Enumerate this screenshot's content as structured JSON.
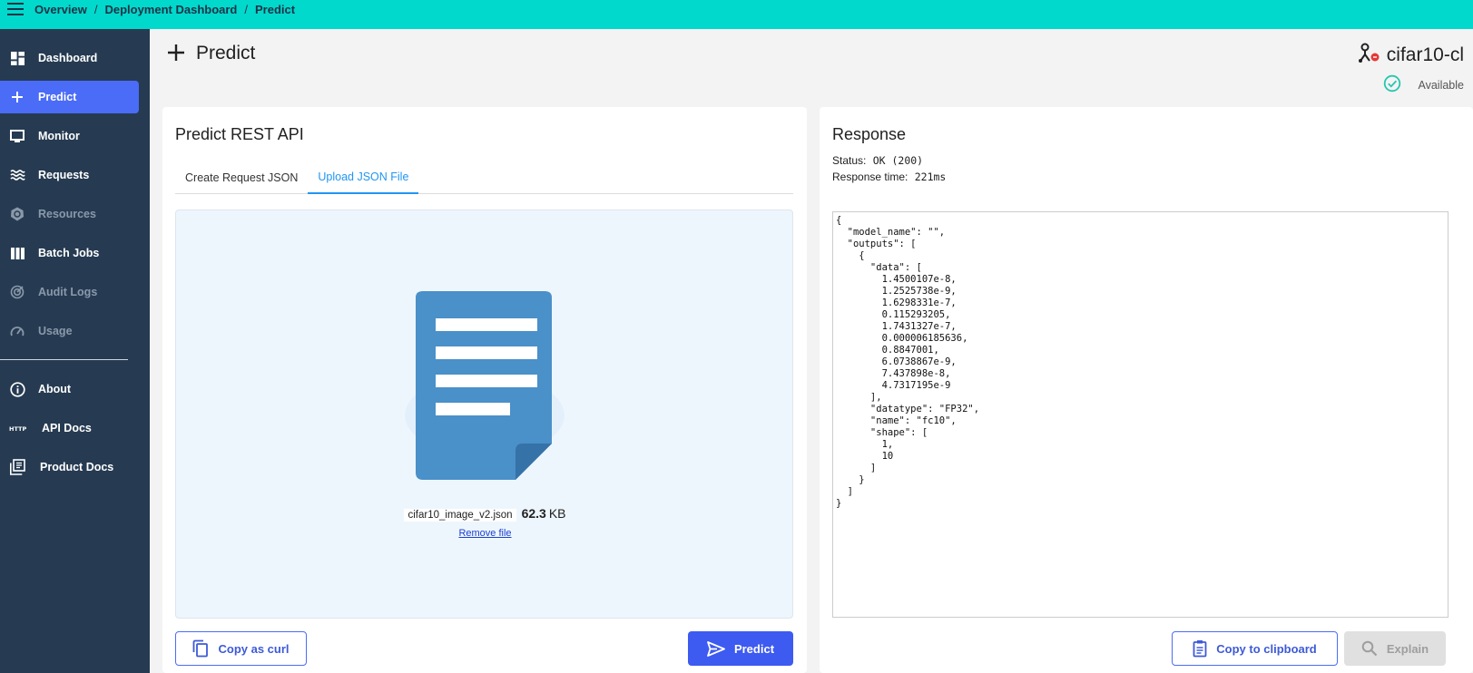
{
  "breadcrumb": {
    "items": [
      "Overview",
      "Deployment Dashboard",
      "Predict"
    ],
    "separator": "/"
  },
  "sidebar": {
    "items": [
      {
        "label": "Dashboard",
        "icon": "dashboard-icon",
        "state": "normal"
      },
      {
        "label": "Predict",
        "icon": "plus-icon",
        "state": "active"
      },
      {
        "label": "Monitor",
        "icon": "monitor-icon",
        "state": "normal"
      },
      {
        "label": "Requests",
        "icon": "waves-icon",
        "state": "normal"
      },
      {
        "label": "Resources",
        "icon": "kubernetes-icon",
        "state": "disabled"
      },
      {
        "label": "Batch Jobs",
        "icon": "batch-icon",
        "state": "normal"
      },
      {
        "label": "Audit Logs",
        "icon": "audit-icon",
        "state": "disabled"
      },
      {
        "label": "Usage",
        "icon": "speedometer-icon",
        "state": "disabled"
      },
      {
        "label": "About",
        "icon": "info-icon",
        "state": "normal"
      },
      {
        "label": "API Docs",
        "icon": "http-icon",
        "state": "normal"
      },
      {
        "label": "Product Docs",
        "icon": "library-icon",
        "state": "normal"
      }
    ]
  },
  "page": {
    "title": "Predict",
    "model_name": "cifar10-cl",
    "model_status": "Available"
  },
  "predict_card": {
    "title": "Predict REST API",
    "tabs": [
      "Create Request JSON",
      "Upload JSON File"
    ],
    "active_tab": "Upload JSON File",
    "file_name": "cifar10_image_v2.json",
    "file_size": "62.3",
    "file_size_unit": "KB",
    "remove_label": "Remove file",
    "copy_curl_label": "Copy as curl",
    "predict_label": "Predict"
  },
  "response_card": {
    "title": "Response",
    "status_label": "Status:",
    "status_value": "OK (200)",
    "time_label": "Response time:",
    "time_value": "221ms",
    "json_text": "{\n  \"model_name\": \"\",\n  \"outputs\": [\n    {\n      \"data\": [\n        1.4500107e-8,\n        1.2525738e-9,\n        1.6298331e-7,\n        0.115293205,\n        1.7431327e-7,\n        0.000006185636,\n        0.8847001,\n        6.0738867e-9,\n        7.437898e-8,\n        4.7317195e-9\n      ],\n      \"datatype\": \"FP32\",\n      \"name\": \"fc10\",\n      \"shape\": [\n        1,\n        10\n      ]\n    }\n  ]\n}",
    "copy_label": "Copy to clipboard",
    "explain_label": "Explain"
  },
  "colors": {
    "topbar": "#00d9cc",
    "sidebar": "#263b52",
    "accent": "#4a6cf7",
    "tab_active": "#2196f3",
    "available": "#26c6b0"
  }
}
